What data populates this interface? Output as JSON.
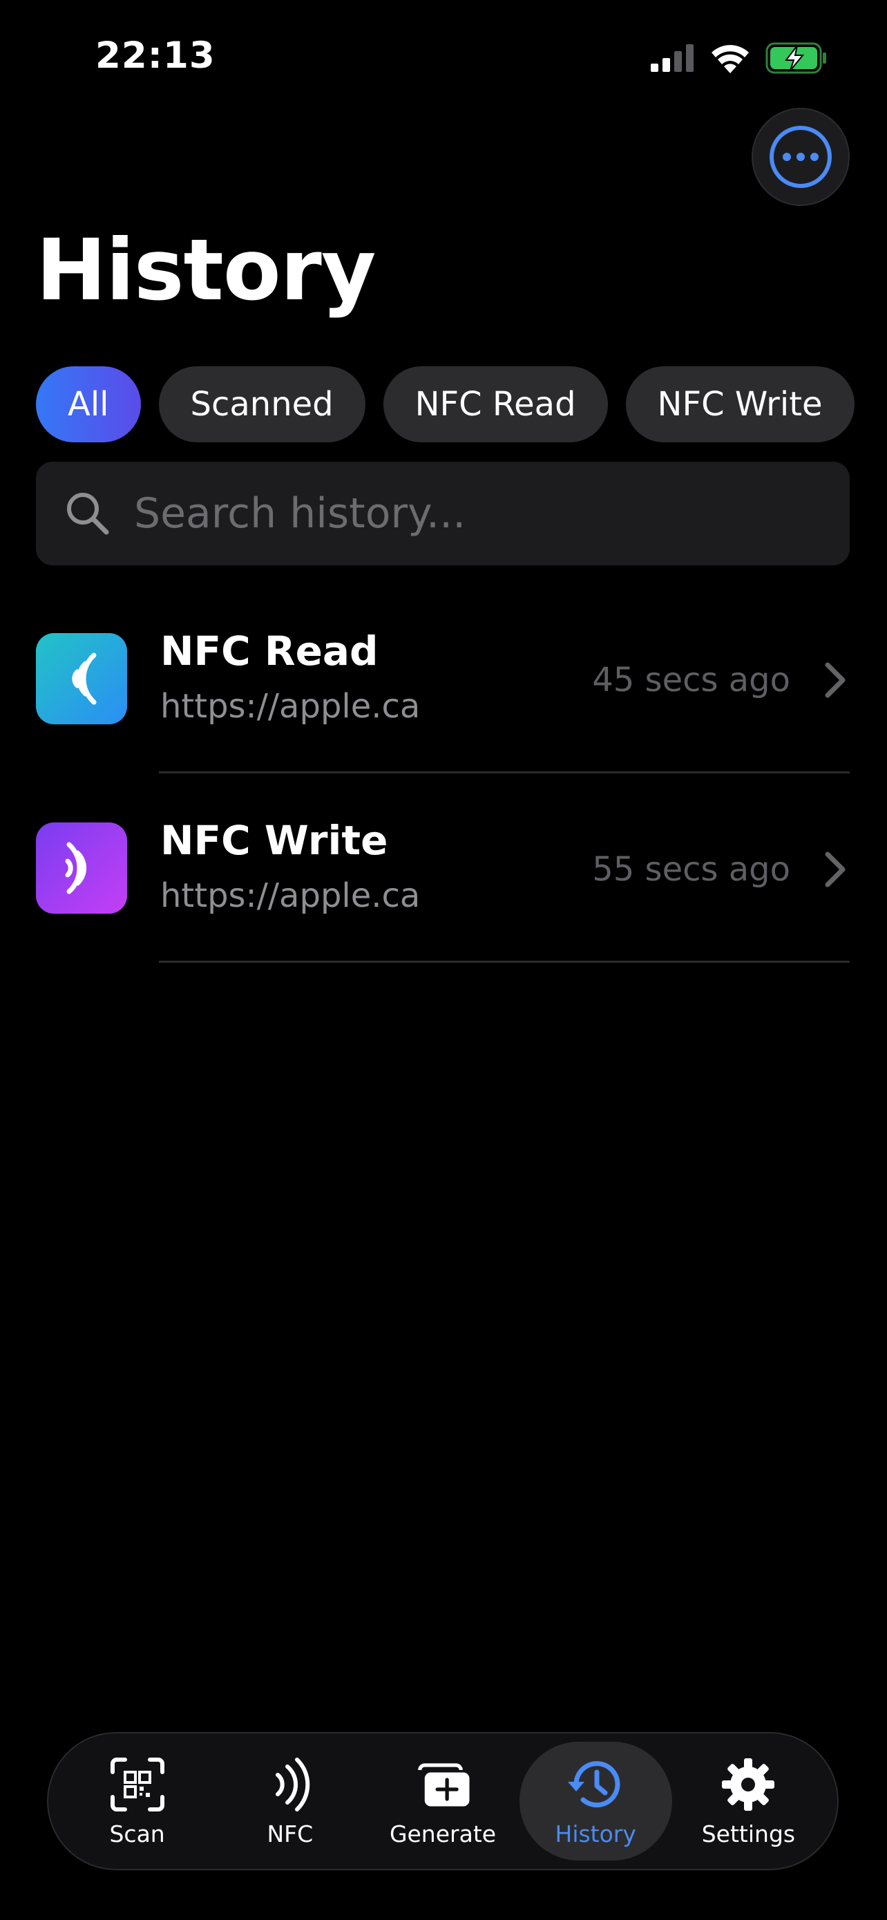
{
  "status_bar": {
    "time": "22:13"
  },
  "header": {
    "title": "History"
  },
  "filters": {
    "chips": [
      {
        "label": "All",
        "active": true
      },
      {
        "label": "Scanned",
        "active": false
      },
      {
        "label": "NFC Read",
        "active": false
      },
      {
        "label": "NFC Write",
        "active": false
      }
    ]
  },
  "search": {
    "placeholder": "Search history...",
    "value": ""
  },
  "history": {
    "items": [
      {
        "title": "NFC Read",
        "subtitle": "https://apple.ca",
        "time": "45 secs ago",
        "icon": "nfc-read-icon"
      },
      {
        "title": "NFC Write",
        "subtitle": "https://apple.ca",
        "time": "55 secs ago",
        "icon": "nfc-write-icon"
      }
    ]
  },
  "tab_bar": {
    "tabs": [
      {
        "label": "Scan",
        "icon": "qr-scan-icon",
        "active": false
      },
      {
        "label": "NFC",
        "icon": "nfc-icon",
        "active": false
      },
      {
        "label": "Generate",
        "icon": "generate-icon",
        "active": false
      },
      {
        "label": "History",
        "icon": "history-icon",
        "active": true
      },
      {
        "label": "Settings",
        "icon": "gear-icon",
        "active": false
      }
    ]
  },
  "colors": {
    "accent": "#3478f6",
    "active_tab": "#4a8bf5",
    "background": "#000000"
  }
}
